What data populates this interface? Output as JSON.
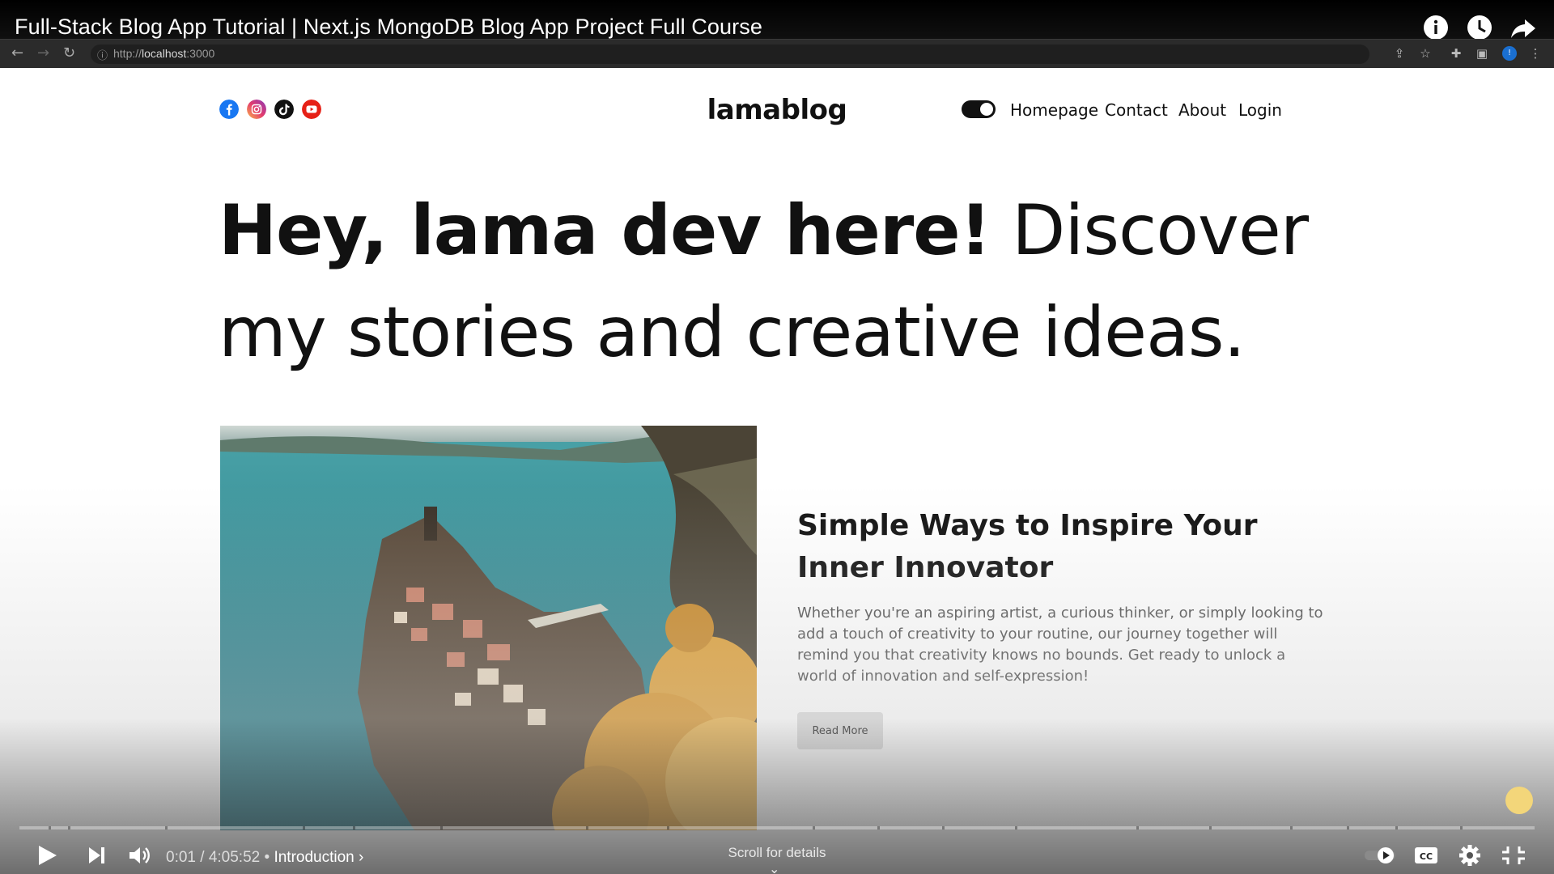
{
  "video": {
    "title": "Full-Stack Blog App Tutorial | Next.js MongoDB Blog App Project Full Course",
    "icons": [
      "info-icon",
      "watch-later-icon",
      "share-icon"
    ]
  },
  "browser": {
    "url_prefix": "http://",
    "url_host": "localhost",
    "url_port": ":3000"
  },
  "blog": {
    "logo": "lamablog",
    "nav": [
      "Homepage",
      "Contact",
      "About",
      "Login"
    ],
    "social_icons": [
      "facebook-icon",
      "instagram-icon",
      "tiktok-icon",
      "youtube-icon"
    ],
    "hero_bold": "Hey, lama dev here!",
    "hero_rest": " Discover my stories and creative ideas.",
    "post_title": "Simple Ways to Inspire Your Inner Innovator",
    "post_desc": "Whether you're an aspiring artist, a curious thinker, or simply looking to add a touch of creativity to your routine, our journey together will remind you that creativity knows no bounds. Get ready to unlock a world of innovation and self-expression!",
    "read_more": "Read More",
    "theme_mode": "dark-toggle"
  },
  "player": {
    "current_time": "0:01",
    "duration": "4:05:52",
    "chapter": "Introduction",
    "scroll_hint": "Scroll for details",
    "progress_fraction": 0.0001
  }
}
